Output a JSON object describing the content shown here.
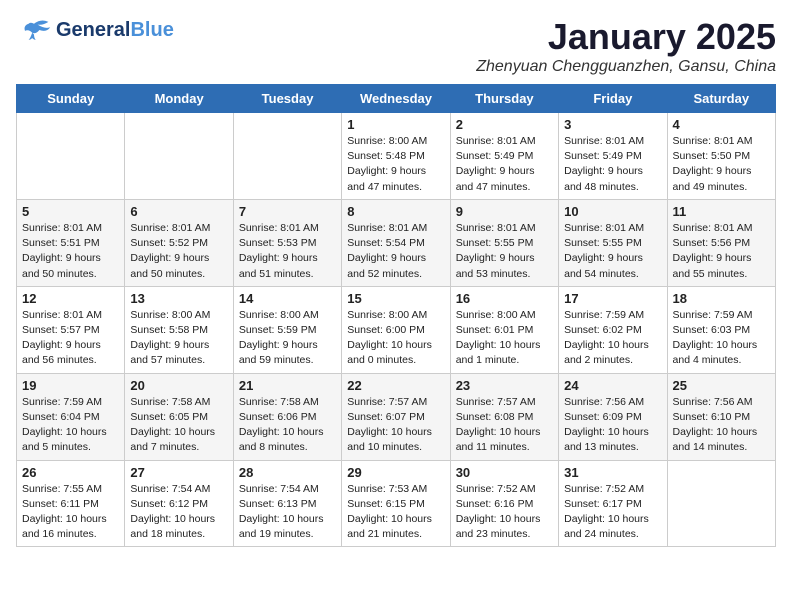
{
  "header": {
    "logo_line1": "General",
    "logo_line2": "Blue",
    "month": "January 2025",
    "location": "Zhenyuan Chengguanzhen, Gansu, China"
  },
  "days_of_week": [
    "Sunday",
    "Monday",
    "Tuesday",
    "Wednesday",
    "Thursday",
    "Friday",
    "Saturday"
  ],
  "weeks": [
    [
      {
        "day": "",
        "info": ""
      },
      {
        "day": "",
        "info": ""
      },
      {
        "day": "",
        "info": ""
      },
      {
        "day": "1",
        "info": "Sunrise: 8:00 AM\nSunset: 5:48 PM\nDaylight: 9 hours\nand 47 minutes."
      },
      {
        "day": "2",
        "info": "Sunrise: 8:01 AM\nSunset: 5:49 PM\nDaylight: 9 hours\nand 47 minutes."
      },
      {
        "day": "3",
        "info": "Sunrise: 8:01 AM\nSunset: 5:49 PM\nDaylight: 9 hours\nand 48 minutes."
      },
      {
        "day": "4",
        "info": "Sunrise: 8:01 AM\nSunset: 5:50 PM\nDaylight: 9 hours\nand 49 minutes."
      }
    ],
    [
      {
        "day": "5",
        "info": "Sunrise: 8:01 AM\nSunset: 5:51 PM\nDaylight: 9 hours\nand 50 minutes."
      },
      {
        "day": "6",
        "info": "Sunrise: 8:01 AM\nSunset: 5:52 PM\nDaylight: 9 hours\nand 50 minutes."
      },
      {
        "day": "7",
        "info": "Sunrise: 8:01 AM\nSunset: 5:53 PM\nDaylight: 9 hours\nand 51 minutes."
      },
      {
        "day": "8",
        "info": "Sunrise: 8:01 AM\nSunset: 5:54 PM\nDaylight: 9 hours\nand 52 minutes."
      },
      {
        "day": "9",
        "info": "Sunrise: 8:01 AM\nSunset: 5:55 PM\nDaylight: 9 hours\nand 53 minutes."
      },
      {
        "day": "10",
        "info": "Sunrise: 8:01 AM\nSunset: 5:55 PM\nDaylight: 9 hours\nand 54 minutes."
      },
      {
        "day": "11",
        "info": "Sunrise: 8:01 AM\nSunset: 5:56 PM\nDaylight: 9 hours\nand 55 minutes."
      }
    ],
    [
      {
        "day": "12",
        "info": "Sunrise: 8:01 AM\nSunset: 5:57 PM\nDaylight: 9 hours\nand 56 minutes."
      },
      {
        "day": "13",
        "info": "Sunrise: 8:00 AM\nSunset: 5:58 PM\nDaylight: 9 hours\nand 57 minutes."
      },
      {
        "day": "14",
        "info": "Sunrise: 8:00 AM\nSunset: 5:59 PM\nDaylight: 9 hours\nand 59 minutes."
      },
      {
        "day": "15",
        "info": "Sunrise: 8:00 AM\nSunset: 6:00 PM\nDaylight: 10 hours\nand 0 minutes."
      },
      {
        "day": "16",
        "info": "Sunrise: 8:00 AM\nSunset: 6:01 PM\nDaylight: 10 hours\nand 1 minute."
      },
      {
        "day": "17",
        "info": "Sunrise: 7:59 AM\nSunset: 6:02 PM\nDaylight: 10 hours\nand 2 minutes."
      },
      {
        "day": "18",
        "info": "Sunrise: 7:59 AM\nSunset: 6:03 PM\nDaylight: 10 hours\nand 4 minutes."
      }
    ],
    [
      {
        "day": "19",
        "info": "Sunrise: 7:59 AM\nSunset: 6:04 PM\nDaylight: 10 hours\nand 5 minutes."
      },
      {
        "day": "20",
        "info": "Sunrise: 7:58 AM\nSunset: 6:05 PM\nDaylight: 10 hours\nand 7 minutes."
      },
      {
        "day": "21",
        "info": "Sunrise: 7:58 AM\nSunset: 6:06 PM\nDaylight: 10 hours\nand 8 minutes."
      },
      {
        "day": "22",
        "info": "Sunrise: 7:57 AM\nSunset: 6:07 PM\nDaylight: 10 hours\nand 10 minutes."
      },
      {
        "day": "23",
        "info": "Sunrise: 7:57 AM\nSunset: 6:08 PM\nDaylight: 10 hours\nand 11 minutes."
      },
      {
        "day": "24",
        "info": "Sunrise: 7:56 AM\nSunset: 6:09 PM\nDaylight: 10 hours\nand 13 minutes."
      },
      {
        "day": "25",
        "info": "Sunrise: 7:56 AM\nSunset: 6:10 PM\nDaylight: 10 hours\nand 14 minutes."
      }
    ],
    [
      {
        "day": "26",
        "info": "Sunrise: 7:55 AM\nSunset: 6:11 PM\nDaylight: 10 hours\nand 16 minutes."
      },
      {
        "day": "27",
        "info": "Sunrise: 7:54 AM\nSunset: 6:12 PM\nDaylight: 10 hours\nand 18 minutes."
      },
      {
        "day": "28",
        "info": "Sunrise: 7:54 AM\nSunset: 6:13 PM\nDaylight: 10 hours\nand 19 minutes."
      },
      {
        "day": "29",
        "info": "Sunrise: 7:53 AM\nSunset: 6:15 PM\nDaylight: 10 hours\nand 21 minutes."
      },
      {
        "day": "30",
        "info": "Sunrise: 7:52 AM\nSunset: 6:16 PM\nDaylight: 10 hours\nand 23 minutes."
      },
      {
        "day": "31",
        "info": "Sunrise: 7:52 AM\nSunset: 6:17 PM\nDaylight: 10 hours\nand 24 minutes."
      },
      {
        "day": "",
        "info": ""
      }
    ]
  ]
}
